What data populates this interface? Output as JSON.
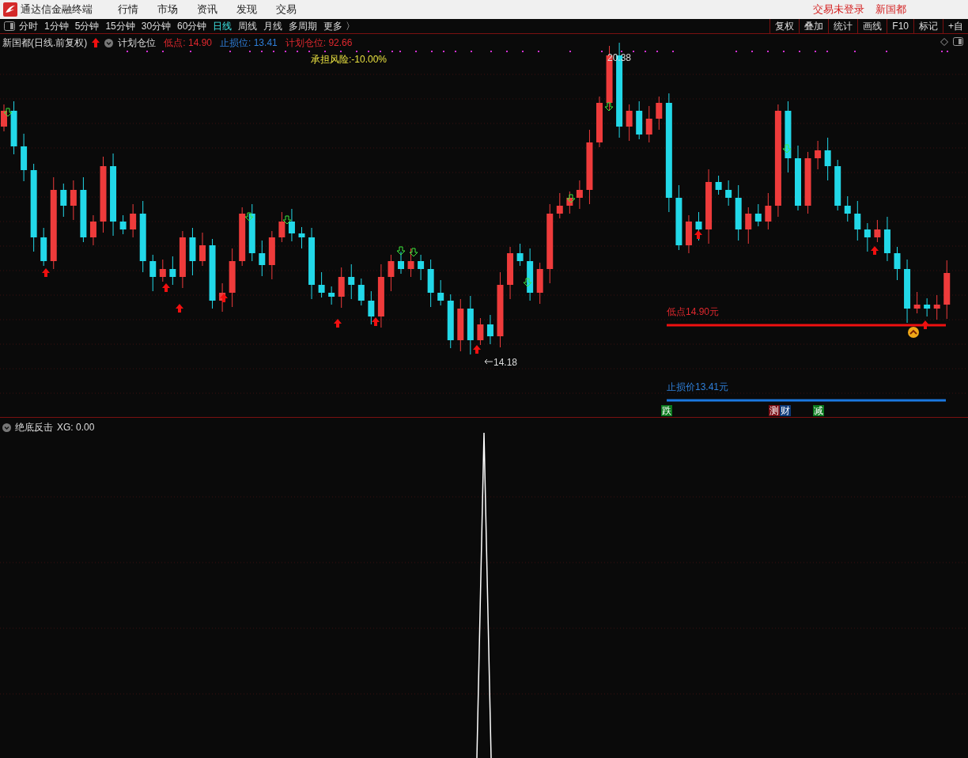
{
  "title_bar": {
    "app_title": "通达信金融终端",
    "menu": [
      "行情",
      "市场",
      "资讯",
      "发现",
      "交易"
    ],
    "status": [
      "交易未登录",
      "新国都"
    ]
  },
  "period_tabs": [
    {
      "label": "分时",
      "selected": false
    },
    {
      "label": "1分钟",
      "selected": false
    },
    {
      "label": "5分钟",
      "selected": false
    },
    {
      "label": "15分钟",
      "selected": false
    },
    {
      "label": "30分钟",
      "selected": false
    },
    {
      "label": "60分钟",
      "selected": false
    },
    {
      "label": "日线",
      "selected": true
    },
    {
      "label": "周线",
      "selected": false
    },
    {
      "label": "月线",
      "selected": false
    },
    {
      "label": "多周期",
      "selected": false
    },
    {
      "label": "更多 〉",
      "selected": false
    }
  ],
  "tools": [
    "复权",
    "叠加",
    "统计",
    "画线",
    "F10",
    "标记",
    "+自"
  ],
  "chart_header": {
    "security": "新国都(日线.前复权)",
    "indicator": "计划仓位",
    "values": [
      {
        "text": "低点: 14.90",
        "color": "#e0282e"
      },
      {
        "text": "止损位: 13.41",
        "color": "#2f7fd8"
      },
      {
        "text": "计划仓位: 92.66",
        "color": "#e0282e"
      }
    ]
  },
  "risk_label": "承担风险:-10.00%",
  "high_label": "20.38",
  "low_label": "14.18",
  "low_line_label": "低点14.90元",
  "stop_line_label": "止损价13.41元",
  "signal_tags": [
    {
      "text": "跌",
      "color": "#0b7a1e"
    },
    {
      "text": "测",
      "color": "#7a0c12"
    },
    {
      "text": "财",
      "color": "#0c3a7a"
    },
    {
      "text": "减",
      "color": "#0b7a1e"
    }
  ],
  "indicator_panel": {
    "name": "绝底反击",
    "value": "XG: 0.00"
  }
}
